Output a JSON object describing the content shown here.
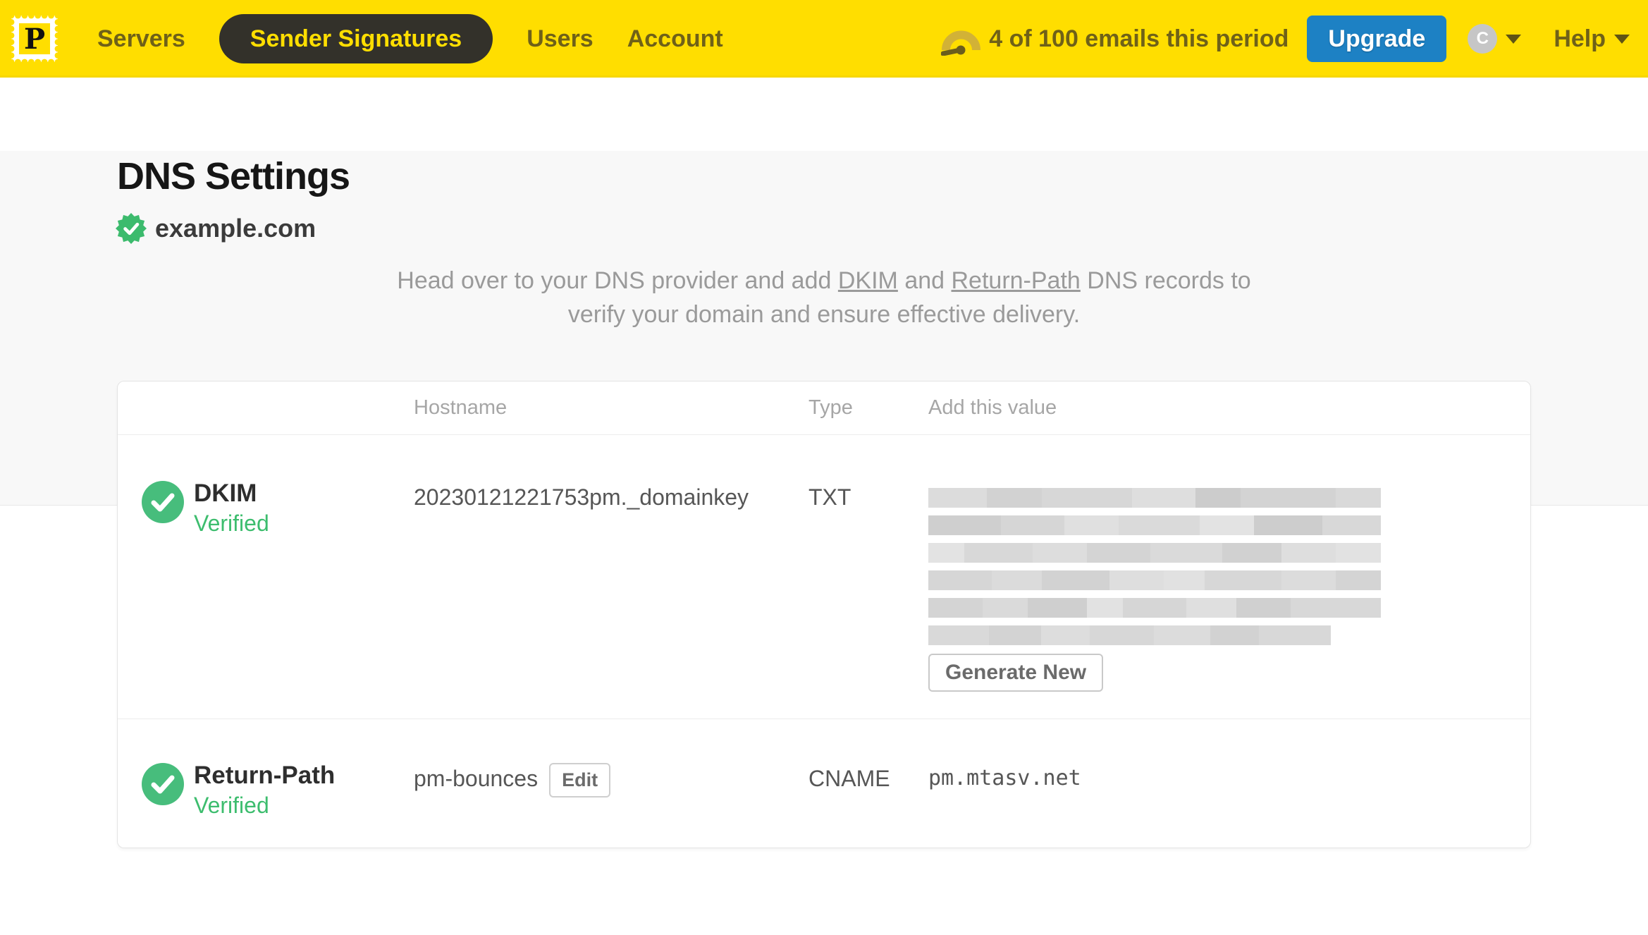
{
  "nav": {
    "logo_letter": "P",
    "items": [
      {
        "label": "Servers",
        "active": false
      },
      {
        "label": "Sender Signatures",
        "active": true
      },
      {
        "label": "Users",
        "active": false
      },
      {
        "label": "Account",
        "active": false
      }
    ],
    "usage_text": "4 of 100 emails this period",
    "upgrade_label": "Upgrade",
    "avatar_initial": "C",
    "help_label": "Help"
  },
  "page": {
    "title": "DNS Settings",
    "domain": "example.com",
    "description": {
      "part1": "Head over to your DNS provider and add ",
      "link1": "DKIM",
      "part2": " and ",
      "link2": "Return-Path",
      "part3": " DNS records to verify your domain and ensure effective delivery."
    }
  },
  "table": {
    "headers": {
      "hostname": "Hostname",
      "type": "Type",
      "value": "Add this value"
    },
    "rows": [
      {
        "name": "DKIM",
        "status": "Verified",
        "hostname": "20230121221753pm._domainkey",
        "type": "TXT",
        "value_redacted": true,
        "action_label": "Generate New",
        "redacted_rows": [
          {
            "width_pct": 100,
            "segments": [
              [
                13,
                "#dcdcdc"
              ],
              [
                12,
                "#d2d2d2"
              ],
              [
                20,
                "#d7d7d7"
              ],
              [
                14,
                "#dedede"
              ],
              [
                10,
                "#cccccc"
              ],
              [
                21,
                "#d3d3d3"
              ],
              [
                10,
                "#d9d9d9"
              ]
            ]
          },
          {
            "width_pct": 100,
            "segments": [
              [
                16,
                "#cfcfcf"
              ],
              [
                14,
                "#d6d6d6"
              ],
              [
                12,
                "#e0e0e0"
              ],
              [
                18,
                "#dadada"
              ],
              [
                12,
                "#e3e3e3"
              ],
              [
                15,
                "#cdcdcd"
              ],
              [
                13,
                "#d8d8d8"
              ]
            ]
          },
          {
            "width_pct": 100,
            "segments": [
              [
                8,
                "#e3e3e3"
              ],
              [
                15,
                "#d8d8d8"
              ],
              [
                12,
                "#dddddd"
              ],
              [
                14,
                "#d4d4d4"
              ],
              [
                16,
                "#dadada"
              ],
              [
                13,
                "#d1d1d1"
              ],
              [
                12,
                "#dedede"
              ],
              [
                10,
                "#e2e2e2"
              ]
            ]
          },
          {
            "width_pct": 100,
            "segments": [
              [
                14,
                "#d6d6d6"
              ],
              [
                11,
                "#dbdbdb"
              ],
              [
                15,
                "#d2d2d2"
              ],
              [
                12,
                "#dedede"
              ],
              [
                9,
                "#e1e1e1"
              ],
              [
                17,
                "#d7d7d7"
              ],
              [
                12,
                "#dcdcdc"
              ],
              [
                10,
                "#d4d4d4"
              ]
            ]
          },
          {
            "width_pct": 100,
            "segments": [
              [
                12,
                "#d4d4d4"
              ],
              [
                10,
                "#dadada"
              ],
              [
                13,
                "#cfcfcf"
              ],
              [
                8,
                "#e2e2e2"
              ],
              [
                14,
                "#d6d6d6"
              ],
              [
                11,
                "#dfdfdf"
              ],
              [
                12,
                "#d0d0d0"
              ],
              [
                20,
                "#d8d8d8"
              ]
            ]
          },
          {
            "width_pct": 89,
            "segments": [
              [
                15,
                "#d9d9d9"
              ],
              [
                13,
                "#d3d3d3"
              ],
              [
                12,
                "#dddddd"
              ],
              [
                16,
                "#d7d7d7"
              ],
              [
                14,
                "#dcdcdc"
              ],
              [
                12,
                "#d2d2d2"
              ],
              [
                18,
                "#d8d8d8"
              ]
            ]
          }
        ]
      },
      {
        "name": "Return-Path",
        "status": "Verified",
        "hostname": "pm-bounces",
        "edit_label": "Edit",
        "type": "CNAME",
        "value": "pm.mtasv.net"
      }
    ]
  },
  "colors": {
    "brand_yellow": "#ffde00",
    "nav_text_olive": "#6f6118",
    "active_pill_bg": "#33312a",
    "upgrade_blue": "#1d81c4",
    "verified_text_green": "#3dbd6e",
    "check_circle_green": "#47bd7c",
    "page_bg_top": "#f8f8f8"
  }
}
